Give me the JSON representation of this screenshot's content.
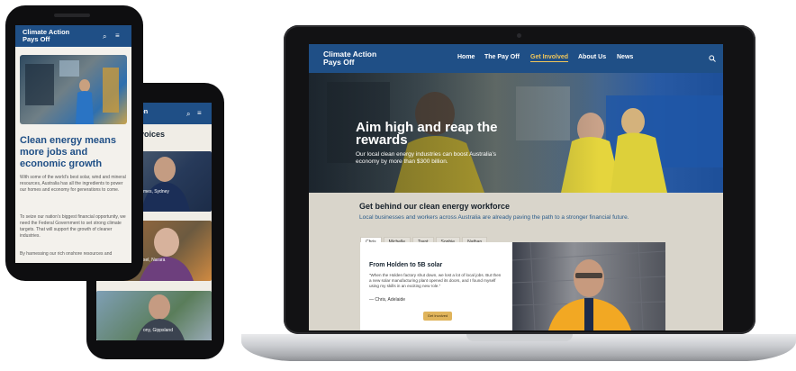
{
  "colors": {
    "brand_blue": "#1f4f86",
    "accent_gold": "#f0c65a",
    "button_gold": "#e0b45b"
  },
  "laptop": {
    "logo": "Climate Action\nPays Off",
    "nav": [
      "Home",
      "The Pay Off",
      "Get Involved",
      "About Us",
      "News"
    ],
    "nav_active": "Get Involved",
    "search_icon": "search-icon",
    "hero": {
      "title": "Aim high and reap the rewards",
      "text": "Our local clean energy industries can boost Australia’s economy by more than $300 billion."
    },
    "section": {
      "title": "Get behind our clean energy workforce",
      "subtitle": "Local businesses and workers across Australia are already paving the path to a stronger financial future."
    },
    "tabs": [
      "Chris",
      "Michelle",
      "Trent",
      "Sophie",
      "Nathan"
    ],
    "tab_active": "Chris",
    "story": {
      "title": "From Holden to 5B solar",
      "quote": "“When the Holden factory shut down, we lost a lot of local jobs. But then a new solar manufacturing plant opened its doors, and I found myself using my skills in an exciting new role.”",
      "author": "— Chris, Adelaide",
      "button": "Get Involved"
    }
  },
  "phone1": {
    "logo": "Climate Action\nPays Off",
    "heading": "Clean energy means more jobs and economic growth",
    "paragraphs": [
      "With some of the world’s best solar, wind and mineral resources, Australia has all the ingredients to power our homes and economy for generations to come.",
      "To seize our nation’s biggest financial opportunity, we need the Federal Government to set strong climate targets. That will support the growth of cleaner industries.",
      "By harnessing our rich onshore resources and"
    ]
  },
  "phone2": {
    "logo_fragment": "on",
    "heading_fragment": "voices",
    "captions": [
      "mes, Sydney",
      "sel, Narara",
      "ony, Gippsland"
    ]
  }
}
